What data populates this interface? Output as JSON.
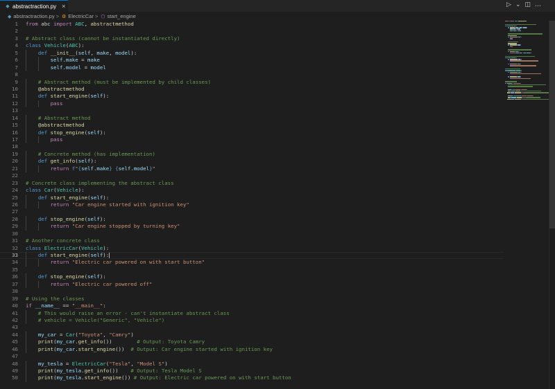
{
  "tab": {
    "label": "abstractraction.py",
    "close": "×"
  },
  "toolbar": {
    "run_icon": "▷",
    "run_menu_icon": "⌄",
    "split_icon": "◫",
    "more_icon": "…"
  },
  "breadcrumb": {
    "file": "abstractraction.py",
    "class": "ElectricCar",
    "method": "start_engine",
    "sep": ">"
  },
  "active_line": 33,
  "colors": {
    "keyword": "#569cd6",
    "control": "#c586c0",
    "function": "#dcdcaa",
    "class": "#4ec9b0",
    "string": "#ce9178",
    "comment": "#6a9955",
    "variable": "#9cdcfe",
    "text": "#d4d4d4"
  },
  "code_lines": [
    [
      [
        "ctrl",
        "from"
      ],
      [
        "t",
        " abc "
      ],
      [
        "ctrl",
        "import"
      ],
      [
        "t",
        " "
      ],
      [
        "cls",
        "ABC"
      ],
      [
        "t",
        ", "
      ],
      [
        "fn",
        "abstractmethod"
      ]
    ],
    [],
    [
      [
        "cm",
        "# Abstract class (cannot be instantiated directly)"
      ]
    ],
    [
      [
        "kw",
        "class"
      ],
      [
        "t",
        " "
      ],
      [
        "cls",
        "Vehicle"
      ],
      [
        "t",
        "("
      ],
      [
        "cls",
        "ABC"
      ],
      [
        "t",
        "):"
      ]
    ],
    [
      [
        "t",
        "    "
      ],
      [
        "kw",
        "def"
      ],
      [
        "t",
        " "
      ],
      [
        "fn",
        "__init__"
      ],
      [
        "t",
        "("
      ],
      [
        "self",
        "self"
      ],
      [
        "t",
        ", "
      ],
      [
        "var",
        "make"
      ],
      [
        "t",
        ", "
      ],
      [
        "var",
        "model"
      ],
      [
        "t",
        "):"
      ]
    ],
    [
      [
        "t",
        "        "
      ],
      [
        "self",
        "self"
      ],
      [
        "t",
        "."
      ],
      [
        "var",
        "make"
      ],
      [
        "t",
        " = "
      ],
      [
        "var",
        "make"
      ]
    ],
    [
      [
        "t",
        "        "
      ],
      [
        "self",
        "self"
      ],
      [
        "t",
        "."
      ],
      [
        "var",
        "model"
      ],
      [
        "t",
        " = "
      ],
      [
        "var",
        "model"
      ]
    ],
    [],
    [
      [
        "t",
        "    "
      ],
      [
        "cm",
        "# Abstract method (must be implemented by child classes)"
      ]
    ],
    [
      [
        "t",
        "    "
      ],
      [
        "dec",
        "@abstractmethod"
      ]
    ],
    [
      [
        "t",
        "    "
      ],
      [
        "kw",
        "def"
      ],
      [
        "t",
        " "
      ],
      [
        "fn",
        "start_engine"
      ],
      [
        "t",
        "("
      ],
      [
        "self",
        "self"
      ],
      [
        "t",
        "):"
      ]
    ],
    [
      [
        "t",
        "        "
      ],
      [
        "ctrl",
        "pass"
      ]
    ],
    [],
    [
      [
        "t",
        "    "
      ],
      [
        "cm",
        "# Abstract method"
      ]
    ],
    [
      [
        "t",
        "    "
      ],
      [
        "dec",
        "@abstractmethod"
      ]
    ],
    [
      [
        "t",
        "    "
      ],
      [
        "kw",
        "def"
      ],
      [
        "t",
        " "
      ],
      [
        "fn",
        "stop_engine"
      ],
      [
        "t",
        "("
      ],
      [
        "self",
        "self"
      ],
      [
        "t",
        "):"
      ]
    ],
    [
      [
        "t",
        "        "
      ],
      [
        "ctrl",
        "pass"
      ]
    ],
    [],
    [
      [
        "t",
        "    "
      ],
      [
        "cm",
        "# Concrete method (has implementation)"
      ]
    ],
    [
      [
        "t",
        "    "
      ],
      [
        "kw",
        "def"
      ],
      [
        "t",
        " "
      ],
      [
        "fn",
        "get_info"
      ],
      [
        "t",
        "("
      ],
      [
        "self",
        "self"
      ],
      [
        "t",
        "):"
      ]
    ],
    [
      [
        "t",
        "        "
      ],
      [
        "ctrl",
        "return"
      ],
      [
        "t",
        " "
      ],
      [
        "kw",
        "f"
      ],
      [
        "str",
        "\""
      ],
      [
        "brace",
        "{"
      ],
      [
        "self",
        "self"
      ],
      [
        "t",
        "."
      ],
      [
        "var",
        "make"
      ],
      [
        "brace",
        "}"
      ],
      [
        "str",
        " "
      ],
      [
        "brace",
        "{"
      ],
      [
        "self",
        "self"
      ],
      [
        "t",
        "."
      ],
      [
        "var",
        "model"
      ],
      [
        "brace",
        "}"
      ],
      [
        "str",
        "\""
      ]
    ],
    [],
    [
      [
        "cm",
        "# Concrete class implementing the abstract class"
      ]
    ],
    [
      [
        "kw",
        "class"
      ],
      [
        "t",
        " "
      ],
      [
        "cls",
        "Car"
      ],
      [
        "t",
        "("
      ],
      [
        "cls",
        "Vehicle"
      ],
      [
        "t",
        "):"
      ]
    ],
    [
      [
        "t",
        "    "
      ],
      [
        "kw",
        "def"
      ],
      [
        "t",
        " "
      ],
      [
        "fn",
        "start_engine"
      ],
      [
        "t",
        "("
      ],
      [
        "self",
        "self"
      ],
      [
        "t",
        "):"
      ]
    ],
    [
      [
        "t",
        "        "
      ],
      [
        "ctrl",
        "return"
      ],
      [
        "t",
        " "
      ],
      [
        "str",
        "\"Car engine started with ignition key\""
      ]
    ],
    [],
    [
      [
        "t",
        "    "
      ],
      [
        "kw",
        "def"
      ],
      [
        "t",
        " "
      ],
      [
        "fn",
        "stop_engine"
      ],
      [
        "t",
        "("
      ],
      [
        "self",
        "self"
      ],
      [
        "t",
        "):"
      ]
    ],
    [
      [
        "t",
        "        "
      ],
      [
        "ctrl",
        "return"
      ],
      [
        "t",
        " "
      ],
      [
        "str",
        "\"Car engine stopped by turning key\""
      ]
    ],
    [],
    [
      [
        "cm",
        "# Another concrete class"
      ]
    ],
    [
      [
        "kw",
        "class"
      ],
      [
        "t",
        " "
      ],
      [
        "cls",
        "ElectricCar"
      ],
      [
        "t",
        "("
      ],
      [
        "cls",
        "Vehicle"
      ],
      [
        "t",
        "):"
      ]
    ],
    [
      [
        "t",
        "    "
      ],
      [
        "kw",
        "def"
      ],
      [
        "t",
        " "
      ],
      [
        "fn",
        "start_engine"
      ],
      [
        "t",
        "("
      ],
      [
        "self",
        "self"
      ],
      [
        "t",
        "):"
      ]
    ],
    [
      [
        "t",
        "        "
      ],
      [
        "ctrl",
        "return"
      ],
      [
        "t",
        " "
      ],
      [
        "str",
        "\"Electric car powered on with start button\""
      ]
    ],
    [],
    [
      [
        "t",
        "    "
      ],
      [
        "kw",
        "def"
      ],
      [
        "t",
        " "
      ],
      [
        "fn",
        "stop_engine"
      ],
      [
        "t",
        "("
      ],
      [
        "self",
        "self"
      ],
      [
        "t",
        "):"
      ]
    ],
    [
      [
        "t",
        "        "
      ],
      [
        "ctrl",
        "return"
      ],
      [
        "t",
        " "
      ],
      [
        "str",
        "\"Electric car powered off\""
      ]
    ],
    [],
    [
      [
        "cm",
        "# Using the classes"
      ]
    ],
    [
      [
        "ctrl",
        "if"
      ],
      [
        "t",
        " "
      ],
      [
        "var",
        "__name__"
      ],
      [
        "t",
        " == "
      ],
      [
        "str",
        "\"__main__\""
      ],
      [
        "t",
        ":"
      ]
    ],
    [
      [
        "t",
        "    "
      ],
      [
        "cm",
        "# This would raise an error - can't instantiate abstract class"
      ]
    ],
    [
      [
        "t",
        "    "
      ],
      [
        "cm",
        "# vehicle = Vehicle(\"Generic\", \"Vehicle\")"
      ]
    ],
    [],
    [
      [
        "t",
        "    "
      ],
      [
        "var",
        "my_car"
      ],
      [
        "t",
        " = "
      ],
      [
        "cls",
        "Car"
      ],
      [
        "t",
        "("
      ],
      [
        "str",
        "\"Toyota\""
      ],
      [
        "t",
        ", "
      ],
      [
        "str",
        "\"Camry\""
      ],
      [
        "t",
        ")"
      ]
    ],
    [
      [
        "t",
        "    "
      ],
      [
        "fn",
        "print"
      ],
      [
        "t",
        "("
      ],
      [
        "var",
        "my_car"
      ],
      [
        "t",
        "."
      ],
      [
        "fn",
        "get_info"
      ],
      [
        "t",
        "())        "
      ],
      [
        "cm",
        "# Output: Toyota Camry"
      ]
    ],
    [
      [
        "t",
        "    "
      ],
      [
        "fn",
        "print"
      ],
      [
        "t",
        "("
      ],
      [
        "var",
        "my_car"
      ],
      [
        "t",
        "."
      ],
      [
        "fn",
        "start_engine"
      ],
      [
        "t",
        "())  "
      ],
      [
        "cm",
        "# Output: Car engine started with ignition key"
      ]
    ],
    [],
    [
      [
        "t",
        "    "
      ],
      [
        "var",
        "my_tesla"
      ],
      [
        "t",
        " = "
      ],
      [
        "cls",
        "ElectricCar"
      ],
      [
        "t",
        "("
      ],
      [
        "str",
        "\"Tesla\""
      ],
      [
        "t",
        ", "
      ],
      [
        "str",
        "\"Model S\""
      ],
      [
        "t",
        ")"
      ]
    ],
    [
      [
        "t",
        "    "
      ],
      [
        "fn",
        "print"
      ],
      [
        "t",
        "("
      ],
      [
        "var",
        "my_tesla"
      ],
      [
        "t",
        "."
      ],
      [
        "fn",
        "get_info"
      ],
      [
        "t",
        "())    "
      ],
      [
        "cm",
        "# Output: Tesla Model S"
      ]
    ],
    [
      [
        "t",
        "    "
      ],
      [
        "fn",
        "print"
      ],
      [
        "t",
        "("
      ],
      [
        "var",
        "my_tesla"
      ],
      [
        "t",
        "."
      ],
      [
        "fn",
        "start_engine"
      ],
      [
        "t",
        "()) "
      ],
      [
        "cm",
        "# Output: Electric car powered on with start button"
      ]
    ]
  ]
}
